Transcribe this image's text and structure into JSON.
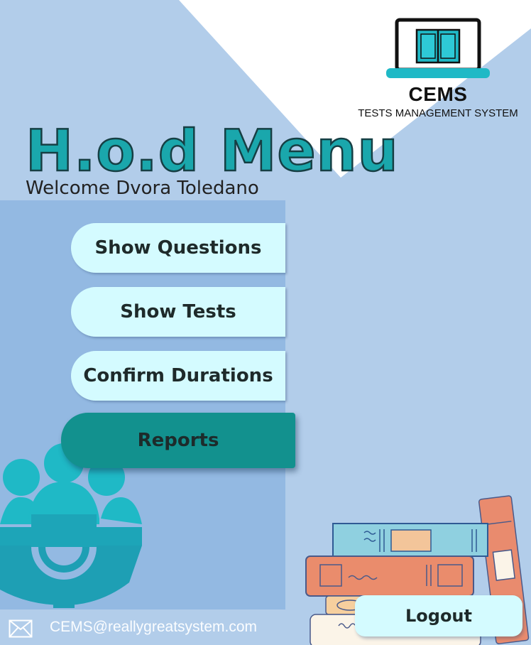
{
  "logo": {
    "name": "CEMS",
    "subtitle": "TESTS MANAGEMENT SYSTEM"
  },
  "header": {
    "title": "H.o.d Menu",
    "welcome": "Welcome Dvora Toledano"
  },
  "menu": {
    "items": [
      {
        "label": "Show Questions",
        "active": false
      },
      {
        "label": "Show Tests",
        "active": false
      },
      {
        "label": "Confirm Durations",
        "active": false
      },
      {
        "label": "Reports",
        "active": true
      }
    ]
  },
  "footer": {
    "email": "CEMS@reallygreatsystem.com"
  },
  "logout": {
    "label": "Logout"
  },
  "colors": {
    "background": "#b2cdea",
    "panel": "#93b9e2",
    "button": "#d4fbff",
    "active_button": "#12918e",
    "title": "#1aa7ac"
  },
  "icons": [
    "laptop-book-logo-icon",
    "team-gear-icon",
    "books-stack-illustration",
    "mail-icon"
  ]
}
